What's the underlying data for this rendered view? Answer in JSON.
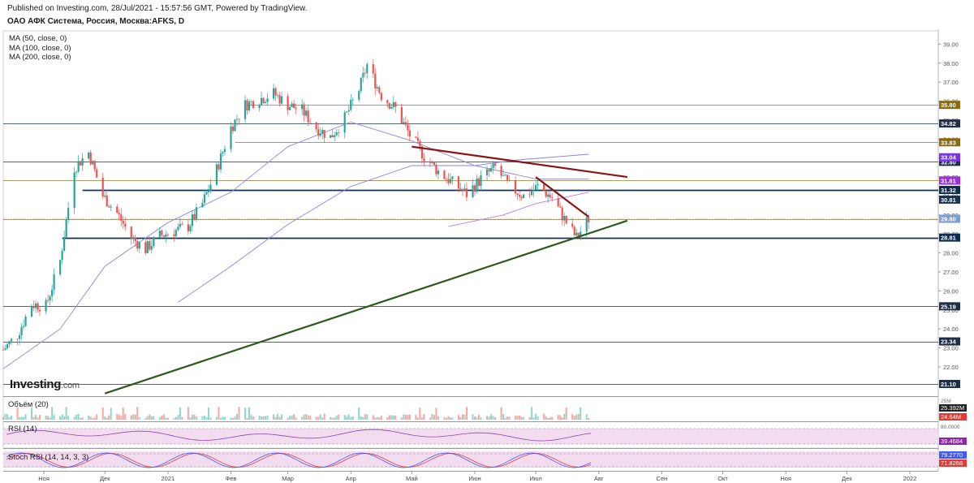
{
  "header": {
    "published": "Published on Investing.com, 28/Jul/2021 - 15:57:56 GMT, Powered by TradingView.",
    "title": "ОАО АФК Система, Россия, Москва:AFKS, D"
  },
  "indicators_legend": [
    "MA (50, close, 0)",
    "MA (100, close, 0)",
    "MA (200, close, 0)"
  ],
  "logo": {
    "main": "Investing",
    "suffix": ".com"
  },
  "colors": {
    "up": "#26a69a",
    "down": "#ef5350",
    "ma": "#8a86e6",
    "gold_line": "#8b7d3a",
    "navy_line": "#14325a",
    "support_trend": "#2d5a1b",
    "resist_trend": "#8b1414",
    "rsi": "#8e44ad",
    "stoch_k": "#3d5afe",
    "stoch_d": "#e53935",
    "band": "#f3dcf0"
  },
  "chart_data": {
    "type": "candlestick",
    "title": "ОАО АФК Система, Россия, Москва:AFKS, D",
    "ylim": [
      20.5,
      39.7
    ],
    "y_ticks": [
      22,
      23,
      24,
      25,
      26,
      27,
      28,
      29,
      30,
      31,
      32,
      33,
      34,
      35,
      36,
      37,
      38,
      39
    ],
    "y_tick_labels": [
      "22.00",
      "23.00",
      "24.00",
      "25.00",
      "26.00",
      "27.00",
      "28.00",
      "29.00",
      "30.00",
      "31.00",
      "32.00",
      "33.00",
      "34.00",
      "35.00",
      "36.00",
      "37.00",
      "38.00",
      "39.00"
    ],
    "x_range": [
      "2020-10-12",
      "2022-01-15"
    ],
    "x_ticks": [
      {
        "date": "2020-11-01",
        "label": "Ноя"
      },
      {
        "date": "2020-12-01",
        "label": "Дек"
      },
      {
        "date": "2021-01-01",
        "label": "2021"
      },
      {
        "date": "2021-02-01",
        "label": "Фев"
      },
      {
        "date": "2021-03-01",
        "label": "Мар"
      },
      {
        "date": "2021-04-01",
        "label": "Апр"
      },
      {
        "date": "2021-05-01",
        "label": "Май"
      },
      {
        "date": "2021-06-01",
        "label": "Июн"
      },
      {
        "date": "2021-07-01",
        "label": "Июл"
      },
      {
        "date": "2021-08-01",
        "label": "Авг"
      },
      {
        "date": "2021-09-01",
        "label": "Сен"
      },
      {
        "date": "2021-10-01",
        "label": "Окт"
      },
      {
        "date": "2021-11-01",
        "label": "Ноя"
      },
      {
        "date": "2021-12-01",
        "label": "Дек"
      },
      {
        "date": "2022-01-01",
        "label": "2022"
      }
    ],
    "close_path": [
      [
        "2020-10-12",
        22.9
      ],
      [
        "2020-10-19",
        23.7
      ],
      [
        "2020-10-26",
        25.3
      ],
      [
        "2020-11-02",
        25.2
      ],
      [
        "2020-11-09",
        27.6
      ],
      [
        "2020-11-16",
        32.5
      ],
      [
        "2020-11-23",
        33.3
      ],
      [
        "2020-11-30",
        31.0
      ],
      [
        "2020-12-07",
        30.1
      ],
      [
        "2020-12-14",
        28.8
      ],
      [
        "2020-12-21",
        28.2
      ],
      [
        "2020-12-28",
        28.9
      ],
      [
        "2021-01-11",
        29.4
      ],
      [
        "2021-01-18",
        30.6
      ],
      [
        "2021-01-25",
        32.4
      ],
      [
        "2021-02-01",
        34.6
      ],
      [
        "2021-02-08",
        35.8
      ],
      [
        "2021-02-15",
        36.1
      ],
      [
        "2021-02-22",
        36.4
      ],
      [
        "2021-03-01",
        35.8
      ],
      [
        "2021-03-08",
        35.5
      ],
      [
        "2021-03-15",
        34.6
      ],
      [
        "2021-03-22",
        34.1
      ],
      [
        "2021-03-29",
        35.1
      ],
      [
        "2021-04-05",
        36.6
      ],
      [
        "2021-04-09",
        37.9
      ],
      [
        "2021-04-16",
        36.3
      ],
      [
        "2021-04-23",
        35.6
      ],
      [
        "2021-04-30",
        34.2
      ],
      [
        "2021-05-07",
        33.1
      ],
      [
        "2021-05-14",
        32.3
      ],
      [
        "2021-05-21",
        31.7
      ],
      [
        "2021-05-28",
        31.1
      ],
      [
        "2021-06-04",
        31.9
      ],
      [
        "2021-06-11",
        32.5
      ],
      [
        "2021-06-18",
        31.5
      ],
      [
        "2021-06-25",
        31.0
      ],
      [
        "2021-07-02",
        31.5
      ],
      [
        "2021-07-09",
        30.9
      ],
      [
        "2021-07-16",
        29.6
      ],
      [
        "2021-07-21",
        28.8
      ],
      [
        "2021-07-27",
        29.8
      ]
    ],
    "moving_averages": [
      {
        "name": "MA (50, close, 0)",
        "points": [
          [
            "2020-10-12",
            21.9
          ],
          [
            "2020-11-09",
            24.0
          ],
          [
            "2020-12-01",
            27.3
          ],
          [
            "2021-01-01",
            29.6
          ],
          [
            "2021-02-01",
            31.2
          ],
          [
            "2021-03-01",
            33.6
          ],
          [
            "2021-04-01",
            34.9
          ],
          [
            "2021-05-01",
            33.9
          ],
          [
            "2021-06-01",
            32.6
          ],
          [
            "2021-06-22",
            32.9
          ],
          [
            "2021-07-27",
            33.2
          ]
        ]
      },
      {
        "name": "MA (100, close, 0)",
        "points": [
          [
            "2021-01-06",
            25.4
          ],
          [
            "2021-02-01",
            27.3
          ],
          [
            "2021-03-01",
            29.5
          ],
          [
            "2021-04-01",
            31.5
          ],
          [
            "2021-05-01",
            32.6
          ],
          [
            "2021-06-01",
            32.6
          ],
          [
            "2021-07-01",
            31.9
          ],
          [
            "2021-07-27",
            31.9
          ]
        ]
      },
      {
        "name": "MA (200, close, 0)",
        "points": [
          [
            "2021-05-19",
            29.4
          ],
          [
            "2021-06-15",
            30.0
          ],
          [
            "2021-07-01",
            30.6
          ],
          [
            "2021-07-27",
            31.2
          ]
        ]
      }
    ],
    "horizontal_levels": [
      {
        "value": 35.8,
        "label": "35.80",
        "style": "gold",
        "from": "2021-02-08"
      },
      {
        "value": 34.82,
        "label": "34.82",
        "style": "navy",
        "from": "2020-10-12"
      },
      {
        "value": 33.83,
        "label": "33.83",
        "style": "gold",
        "from": "2021-02-03"
      },
      {
        "value": 32.8,
        "label": "32.80",
        "style": "navy",
        "from": "2020-10-12"
      },
      {
        "value": 31.82,
        "label": "31.82",
        "style": "gold",
        "from": "2020-10-12"
      },
      {
        "value": 31.32,
        "label": "31.32",
        "style": "navy-bold",
        "from": "2020-11-20"
      },
      {
        "value": 29.8,
        "label": "29.80",
        "style": "gold",
        "from": "2020-10-12"
      },
      {
        "value": 28.81,
        "label": "28.81",
        "style": "navy-bold",
        "from": "2020-11-10"
      },
      {
        "value": 25.19,
        "label": "25.19",
        "style": "navy",
        "from": "2020-10-12"
      },
      {
        "value": 23.34,
        "label": "23.34",
        "style": "navy",
        "from": "2020-10-12"
      },
      {
        "value": 21.1,
        "label": "21.10",
        "style": "navy",
        "from": "2020-10-12"
      }
    ],
    "price_labels": [
      {
        "value": 33.04,
        "label": "33.04",
        "color": "#7b2ff7"
      },
      {
        "value": 31.81,
        "label": "31.81",
        "color": "#9b30d9"
      },
      {
        "value": 30.81,
        "label": "30.81",
        "color": "#14325a"
      },
      {
        "value": 29.8,
        "label": "29.80",
        "color": "#7a9cd8"
      }
    ],
    "trend_lines": [
      {
        "name": "support",
        "from": [
          "2020-12-01",
          20.6
        ],
        "to": [
          "2021-08-15",
          29.7
        ],
        "color": "#2d5a1b"
      },
      {
        "name": "resistance",
        "from": [
          "2021-05-01",
          33.6
        ],
        "to": [
          "2021-08-15",
          32.0
        ],
        "color": "#8b1414"
      },
      {
        "name": "resistance-short",
        "from": [
          "2021-07-01",
          32.0
        ],
        "to": [
          "2021-07-27",
          29.9
        ],
        "color": "#8b1414"
      }
    ],
    "panes": [
      {
        "name": "Объём (20)",
        "axis_labels": [
          "25.392M",
          "24.64M",
          "25M"
        ]
      },
      {
        "name": "RSI (14)",
        "axis_labels": [
          "80.0000",
          "39.4684"
        ],
        "value": 39.4684
      },
      {
        "name": "Stoch RSI (14, 14, 3, 3)",
        "axis_labels": [
          "79.2770",
          "71.8268"
        ],
        "k": 79.277,
        "d": 71.8268
      }
    ]
  }
}
